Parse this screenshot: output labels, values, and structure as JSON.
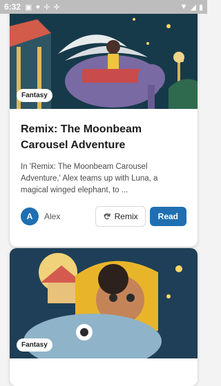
{
  "status_bar": {
    "time": "6:32",
    "icons": [
      "a-icon",
      "pin-icon",
      "wrench-icon",
      "wrench-icon",
      "wifi-icon",
      "signal-icon",
      "battery-icon"
    ]
  },
  "stories": [
    {
      "category": "Fantasy",
      "title": "Remix: The Moonbeam Carousel Adventure",
      "description": "In 'Remix: The Moonbeam Carousel Adventure,' Alex teams up with Luna, a magical winged elephant, to ...",
      "author_initial": "A",
      "author_name": "Alex",
      "remix_label": "Remix",
      "read_label": "Read"
    },
    {
      "category": "Fantasy"
    }
  ],
  "colors": {
    "accent": "#1f6fb2",
    "status_bar": "#bdbdbd"
  }
}
